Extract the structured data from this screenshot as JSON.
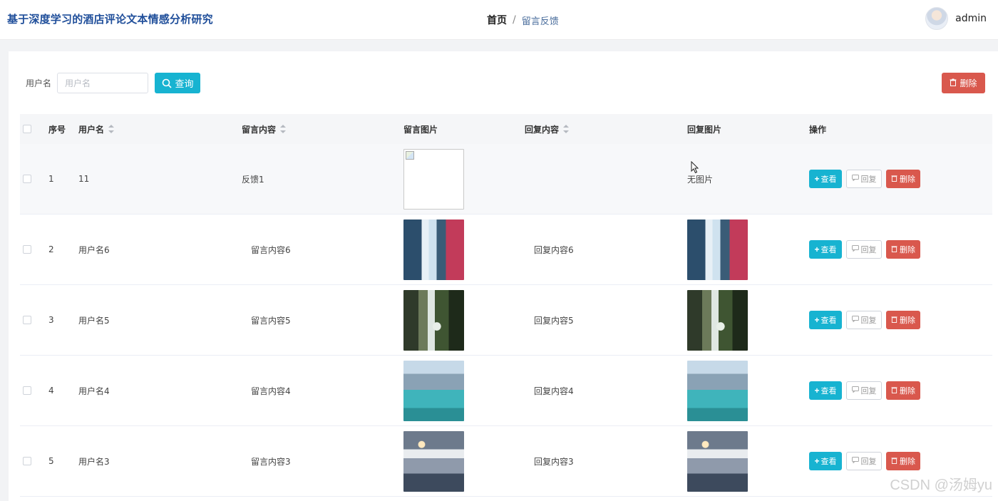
{
  "header": {
    "app_title": "基于深度学习的酒店评论文本情感分析研究",
    "breadcrumb_home": "首页",
    "breadcrumb_sep": "/",
    "breadcrumb_current": "留言反馈",
    "username": "admin"
  },
  "search": {
    "label": "用户名",
    "placeholder": "用户名",
    "button_label": "查询"
  },
  "toolbar": {
    "delete_label": "删除"
  },
  "table": {
    "columns": [
      "序号",
      "用户名",
      "留言内容",
      "留言图片",
      "回复内容",
      "回复图片",
      "操作"
    ],
    "rows": [
      {
        "index": "1",
        "username": "11",
        "message": "反馈1",
        "image": "broken",
        "reply": "",
        "reply_image_text": "无图片",
        "reply_image": "none"
      },
      {
        "index": "2",
        "username": "用户名6",
        "message": "留言内容6",
        "image": "waterfall",
        "reply": "回复内容6",
        "reply_image": "waterfall"
      },
      {
        "index": "3",
        "username": "用户名5",
        "message": "留言内容5",
        "image": "forest-waterfall",
        "reply": "回复内容5",
        "reply_image": "forest-waterfall"
      },
      {
        "index": "4",
        "username": "用户名4",
        "message": "留言内容4",
        "image": "mountain-lake",
        "reply": "回复内容4",
        "reply_image": "mountain-lake"
      },
      {
        "index": "5",
        "username": "用户名3",
        "message": "留言内容3",
        "image": "snowy-mountain",
        "reply": "回复内容3",
        "reply_image": "snowy-mountain"
      }
    ],
    "action_view": "查看",
    "action_reply": "回复",
    "action_delete": "删除"
  },
  "watermark": "CSDN @汤姆yu",
  "colors": {
    "title_blue": "#1f4e9a",
    "primary_cyan": "#17b3d1",
    "danger_red": "#d9584d"
  }
}
